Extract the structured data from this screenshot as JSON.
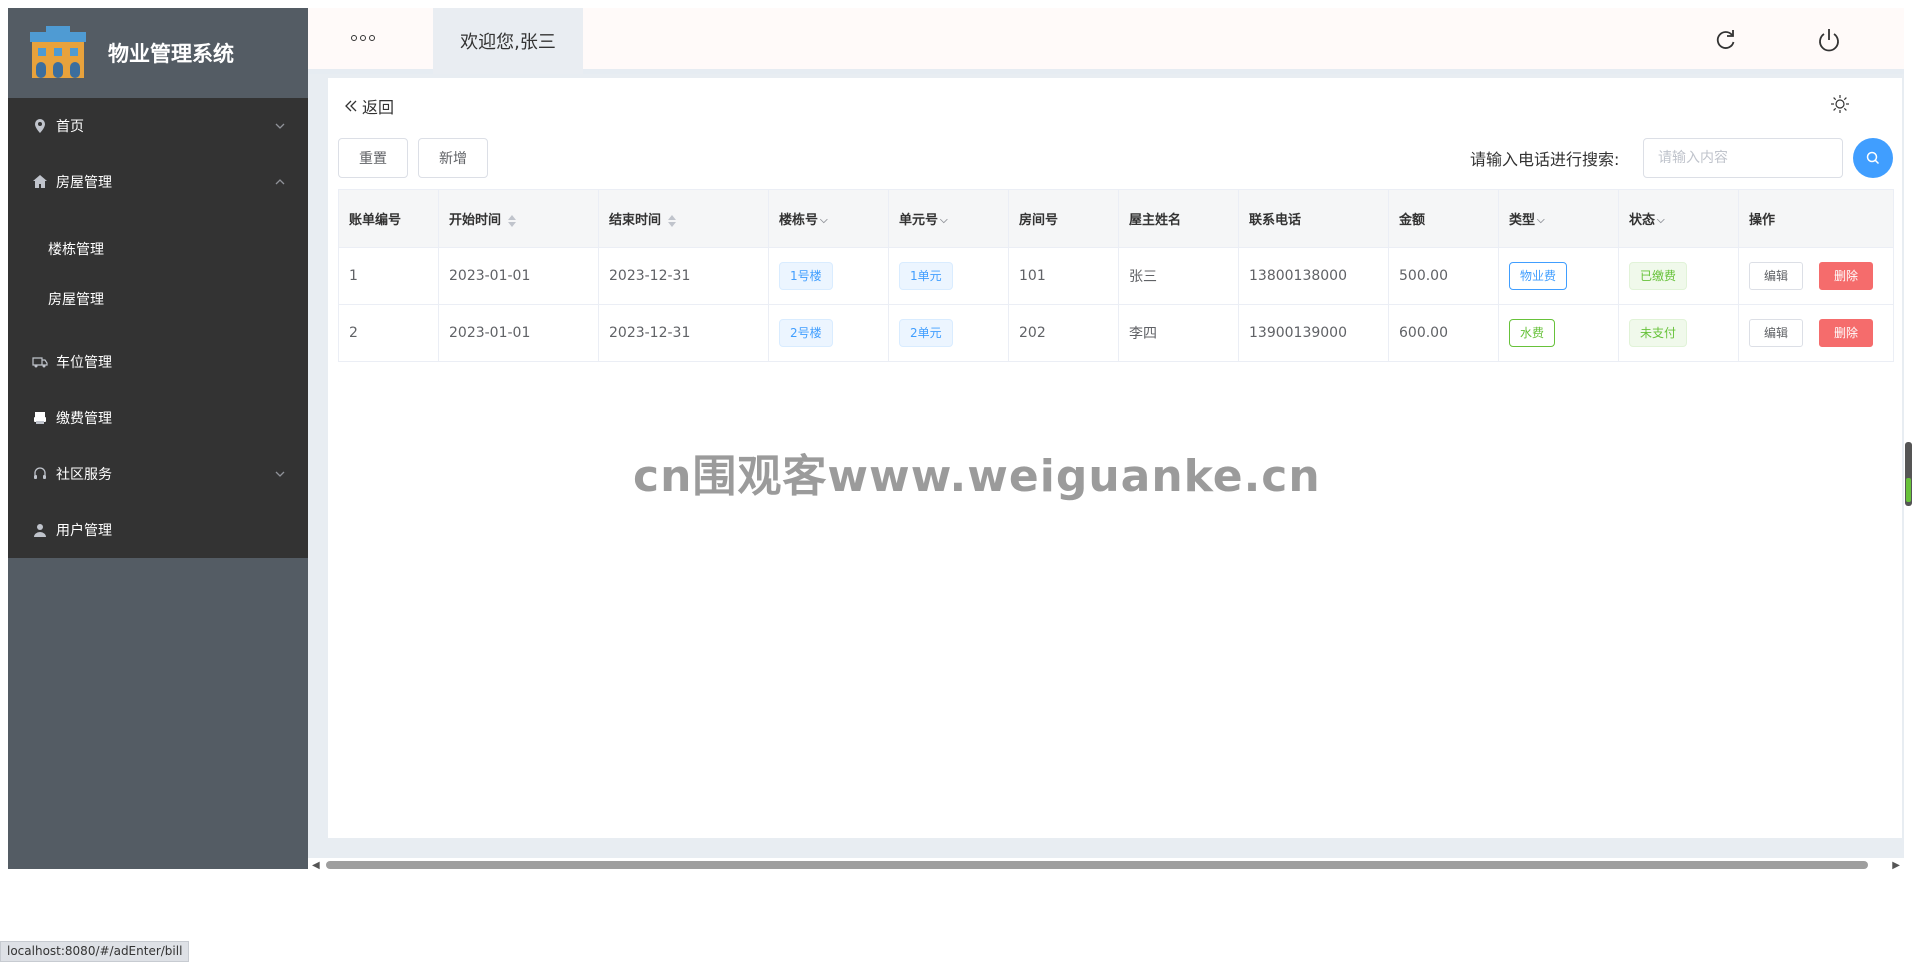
{
  "app": {
    "title": "物业管理系统"
  },
  "sidebar": {
    "items": [
      {
        "label": "首页",
        "icon": "location-pin-icon",
        "expandable": true,
        "expanded": false
      },
      {
        "label": "房屋管理",
        "icon": "home-icon",
        "expandable": true,
        "expanded": true,
        "children": [
          {
            "label": "楼栋管理"
          },
          {
            "label": "房屋管理"
          }
        ]
      },
      {
        "label": "车位管理",
        "icon": "truck-icon",
        "expandable": false
      },
      {
        "label": "缴费管理",
        "icon": "printer-icon",
        "expandable": false
      },
      {
        "label": "社区服务",
        "icon": "headset-icon",
        "expandable": true,
        "expanded": false
      },
      {
        "label": "用户管理",
        "icon": "user-icon",
        "expandable": false
      }
    ]
  },
  "header": {
    "welcome": "欢迎您,张三",
    "icons": [
      "more-dots-icon",
      "refresh-icon",
      "power-icon"
    ]
  },
  "page": {
    "back_label": "返回",
    "reset_label": "重置",
    "add_label": "新增",
    "search_label": "请输入电话进行搜索:",
    "search_placeholder": "请输入内容"
  },
  "table": {
    "columns": [
      "账单编号",
      "开始时间",
      "结束时间",
      "楼栋号",
      "单元号",
      "房间号",
      "屋主姓名",
      "联系电话",
      "金额",
      "类型",
      "状态",
      "操作"
    ],
    "rows": [
      {
        "id": "1",
        "start": "2023-01-01",
        "end": "2023-12-31",
        "building": "1号楼",
        "unit": "1单元",
        "room": "101",
        "owner": "张三",
        "phone": "13800138000",
        "amount": "500.00",
        "type": "物业费",
        "status": "已缴费"
      },
      {
        "id": "2",
        "start": "2023-01-01",
        "end": "2023-12-31",
        "building": "2号楼",
        "unit": "2单元",
        "room": "202",
        "owner": "李四",
        "phone": "13900139000",
        "amount": "600.00",
        "type": "水费",
        "status": "未支付"
      }
    ],
    "edit_label": "编辑",
    "delete_label": "删除"
  },
  "watermark": "cn围观客www.weiguanke.cn",
  "status_bar": "localhost:8080/#/adEnter/bill",
  "colors": {
    "primary": "#409eff",
    "danger": "#f56c6c",
    "success": "#67c23a",
    "sidebar_menu": "#333333",
    "sidebar_bg": "#545c64"
  }
}
